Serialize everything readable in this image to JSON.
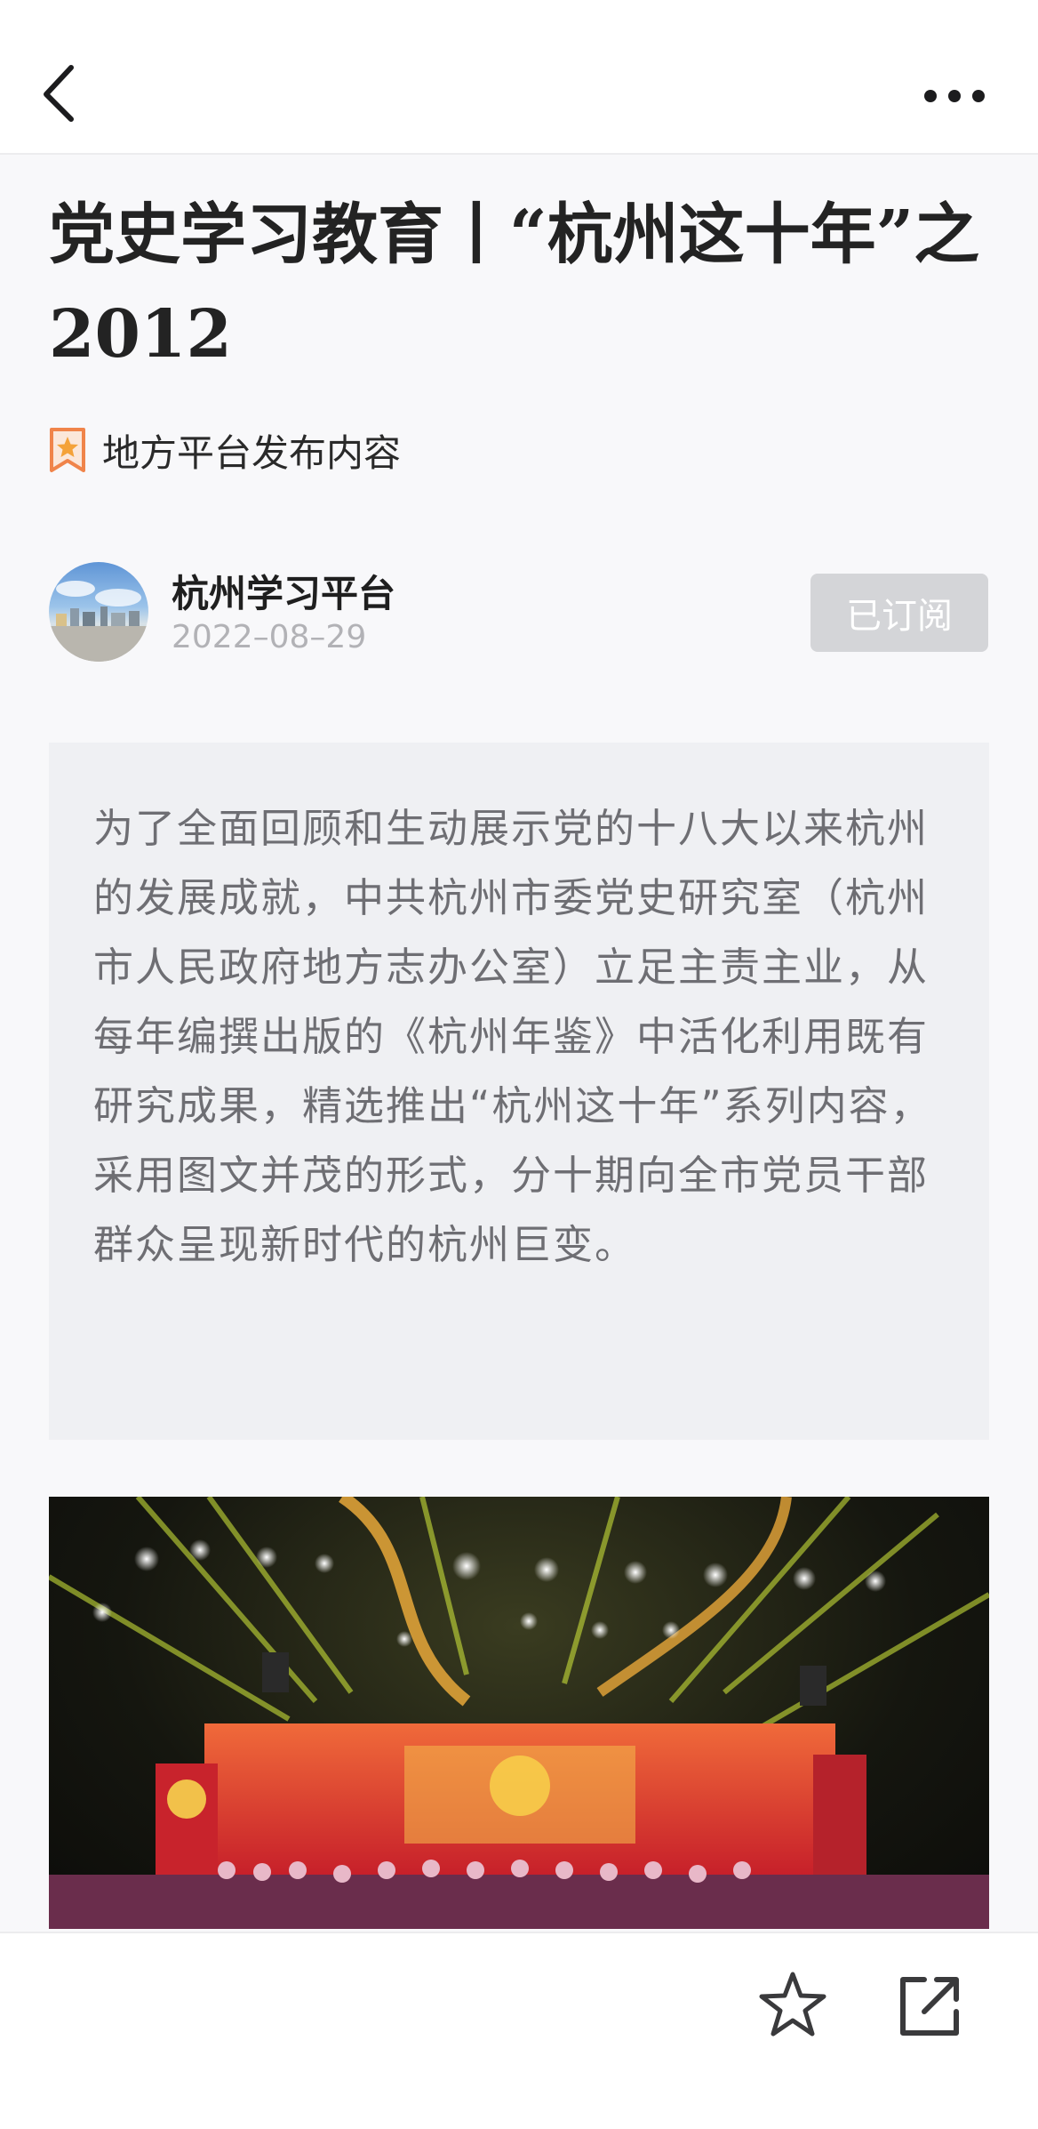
{
  "nav": {
    "back_icon": "chevron-left-icon",
    "more_icon": "more-dots-icon"
  },
  "article": {
    "title": "党史学习教育丨“杭州这十年”之2012",
    "tag_icon": "bookmark-star-icon",
    "tag_text": "地方平台发布内容",
    "tag_color": "#f0844a"
  },
  "author": {
    "name": "杭州学习平台",
    "date": "2022–08–29",
    "subscribe_label": "已订阅"
  },
  "summary": {
    "text": "为了全面回顾和生动展示党的十八大以来杭州的发展成就，中共杭州市委党史研究室（杭州市人民政府地方志办公室）立足主责主业，从每年编撰出版的《杭州年鉴》中活化利用既有研究成果，精选推出“杭州这十年”系列内容，采用图文并茂的形式，分十期向全市党员干部群众呈现新时代的杭州巨变。"
  },
  "bottom_bar": {
    "favorite_icon": "star-outline-icon",
    "share_icon": "share-external-icon"
  }
}
